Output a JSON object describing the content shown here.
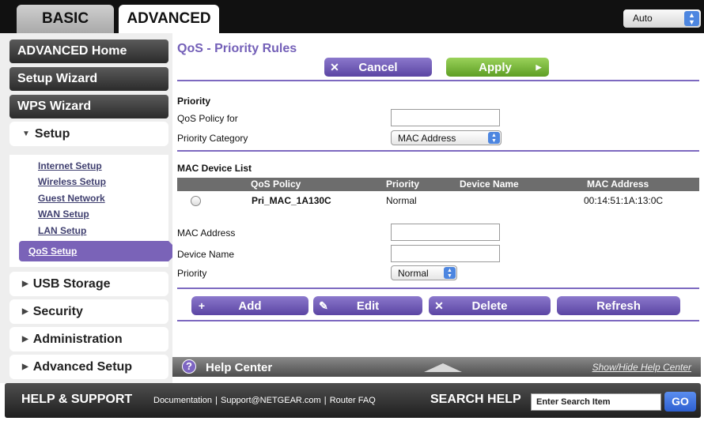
{
  "tabs": {
    "basic": "BASIC",
    "advanced": "ADVANCED"
  },
  "language": {
    "value": "Auto"
  },
  "sidebar": {
    "advanced_home": "ADVANCED Home",
    "setup_wizard": "Setup Wizard",
    "wps_wizard": "WPS Wizard",
    "setup": "Setup",
    "setup_items": [
      "Internet Setup",
      "Wireless Setup",
      "Guest Network",
      "WAN Setup",
      "LAN Setup"
    ],
    "selected_item": "QoS Setup",
    "usb_storage": "USB Storage",
    "security": "Security",
    "administration": "Administration",
    "advanced_setup": "Advanced Setup"
  },
  "main": {
    "title": "QoS - Priority Rules",
    "cancel": "Cancel",
    "apply": "Apply",
    "priority_heading": "Priority",
    "qos_policy_for_label": "QoS Policy for",
    "qos_policy_for_value": "",
    "priority_category_label": "Priority Category",
    "priority_category_value": "MAC Address",
    "mac_list_heading": "MAC Device List",
    "table": {
      "headers": [
        "QoS Policy",
        "Priority",
        "Device Name",
        "MAC Address"
      ],
      "rows": [
        {
          "qos_policy": "Pri_MAC_1A130C",
          "priority": "Normal",
          "device_name": "",
          "mac_address": "00:14:51:1A:13:0C",
          "selected": false
        }
      ]
    },
    "mac_address_label": "MAC Address",
    "mac_address_value": "",
    "device_name_label": "Device Name",
    "device_name_value": "",
    "priority_label": "Priority",
    "priority_value": "Normal",
    "add": "Add",
    "edit": "Edit",
    "delete": "Delete",
    "refresh": "Refresh"
  },
  "help": {
    "title": "Help Center",
    "toggle": "Show/Hide Help Center"
  },
  "footer": {
    "help_support": "HELP & SUPPORT",
    "links": [
      "Documentation",
      "Support@NETGEAR.com",
      "Router FAQ"
    ],
    "search_help": "SEARCH HELP",
    "search_value": "Enter Search Item",
    "go": "GO"
  },
  "colors": {
    "accent_purple": "#7a63b8",
    "apply_green": "#6fb02e",
    "dark_nav": "#2b2b2b"
  }
}
